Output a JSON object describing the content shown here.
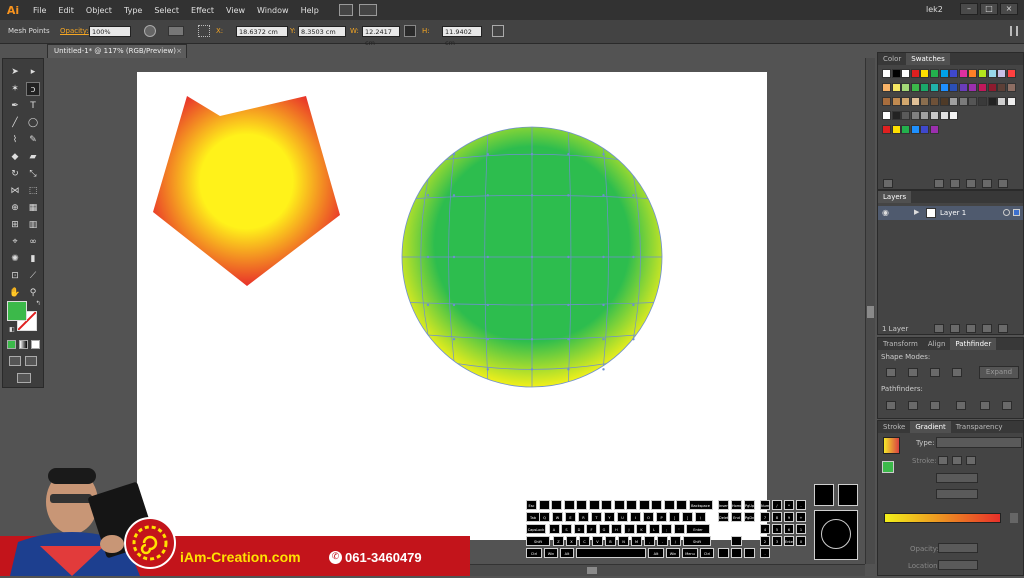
{
  "app": {
    "logo": "Ai",
    "workspace": "lek2"
  },
  "menu": [
    "File",
    "Edit",
    "Object",
    "Type",
    "Select",
    "Effect",
    "View",
    "Window",
    "Help"
  ],
  "window_controls": [
    "–",
    "□",
    "×"
  ],
  "control_bar": {
    "selection_type": "Mesh Points",
    "opacity_label": "Opacity:",
    "opacity_value": "100%",
    "x_label": "X:",
    "x_value": "18.6372 cm",
    "y_label": "Y:",
    "y_value": "8.3503 cm",
    "w_label": "W:",
    "w_value": "12.2417 cm",
    "h_label": "H:",
    "h_value": "11.9402 cm"
  },
  "document_tab": {
    "title": "Untitled-1* @ 117% (RGB/Preview)",
    "close": "×"
  },
  "swatches_panel": {
    "tabs": [
      "Color",
      "Swatches"
    ],
    "active_tab": "Swatches"
  },
  "layers_panel": {
    "title": "Layers",
    "layer_name": "Layer 1",
    "count": "1 Layer"
  },
  "pathfinder_panel": {
    "tabs": [
      "Transform",
      "Align",
      "Pathfinder"
    ],
    "active_tab": "Pathfinder",
    "shape_modes": "Shape Modes:",
    "expand": "Expand",
    "pathfinders": "Pathfinders:"
  },
  "gradient_panel": {
    "tabs": [
      "Stroke",
      "Gradient",
      "Transparency"
    ],
    "active_tab": "Gradient",
    "type_label": "Type:",
    "stroke_label": "Stroke:",
    "opacity_label": "Opacity:",
    "location_label": "Location:"
  },
  "colors": {
    "fill": "#3cb94a",
    "mesh_green": "#2dbd4e",
    "mesh_yellow": "#f2f01a",
    "star_yellow": "#fff21a",
    "star_red": "#e8302a",
    "mesh_line": "#6f8fcf"
  },
  "branding": {
    "site": "iAm-Creation.com",
    "phone": "061-3460479"
  },
  "keyboard_keys": {
    "row1": [
      "Esc",
      "",
      "",
      "",
      "",
      "",
      "",
      "",
      "",
      "",
      "",
      "",
      "",
      "Backspace"
    ],
    "row2": [
      "Tab",
      "Q",
      "W",
      "E",
      "R",
      "T",
      "Y",
      "U",
      "I",
      "O",
      "P",
      "[",
      "]",
      "\\"
    ],
    "row3": [
      "CapsLock",
      "A",
      "S",
      "D",
      "F",
      "G",
      "H",
      "J",
      "K",
      "L",
      ";",
      "'",
      "Enter"
    ],
    "row4": [
      "Shift",
      "Z",
      "X",
      "C",
      "V",
      "B",
      "N",
      "M",
      ",",
      ".",
      "/",
      "Shift"
    ],
    "row5": [
      "Ctrl",
      "Win",
      "Alt",
      "",
      "Alt",
      "Win",
      "Menu",
      "Ctrl"
    ],
    "nav": [
      "Insert",
      "Home",
      "PgUp",
      "Delete",
      "End",
      "PgDn"
    ],
    "numpad": [
      "Num",
      "/",
      "*",
      "-",
      "7",
      "8",
      "9",
      "+",
      "4",
      "5",
      "6",
      "1",
      "2",
      "3",
      "Enter",
      "0",
      "."
    ]
  }
}
